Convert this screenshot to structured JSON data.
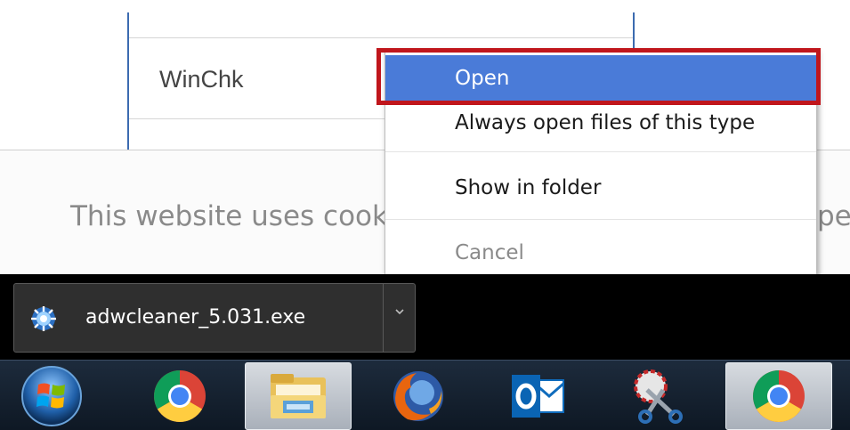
{
  "background_table": {
    "cell_text": "WinChk"
  },
  "cookie_banner": {
    "text_left": "This website uses cooki",
    "text_right": "per"
  },
  "context_menu": {
    "items": [
      {
        "label": "Open",
        "state": "highlighted"
      },
      {
        "label": "Always open files of this type",
        "state": "normal"
      },
      {
        "label": "Show in folder",
        "state": "normal"
      },
      {
        "label": "Cancel",
        "state": "disabled"
      }
    ]
  },
  "download_bar": {
    "file_name": "adwcleaner_5.031.exe",
    "file_icon": "adwcleaner-icon",
    "menu_icon": "chevron-down-icon"
  },
  "taskbar": {
    "items": [
      {
        "icon": "windows-start-icon"
      },
      {
        "icon": "chrome-icon"
      },
      {
        "icon": "file-explorer-icon"
      },
      {
        "icon": "firefox-icon"
      },
      {
        "icon": "outlook-icon"
      },
      {
        "icon": "snipping-tool-icon"
      },
      {
        "icon": "chrome-icon",
        "active": true
      }
    ]
  },
  "colors": {
    "highlight": "#4a7bd8",
    "annotation_red": "#c0161c",
    "table_border": "#3c6bb0"
  }
}
